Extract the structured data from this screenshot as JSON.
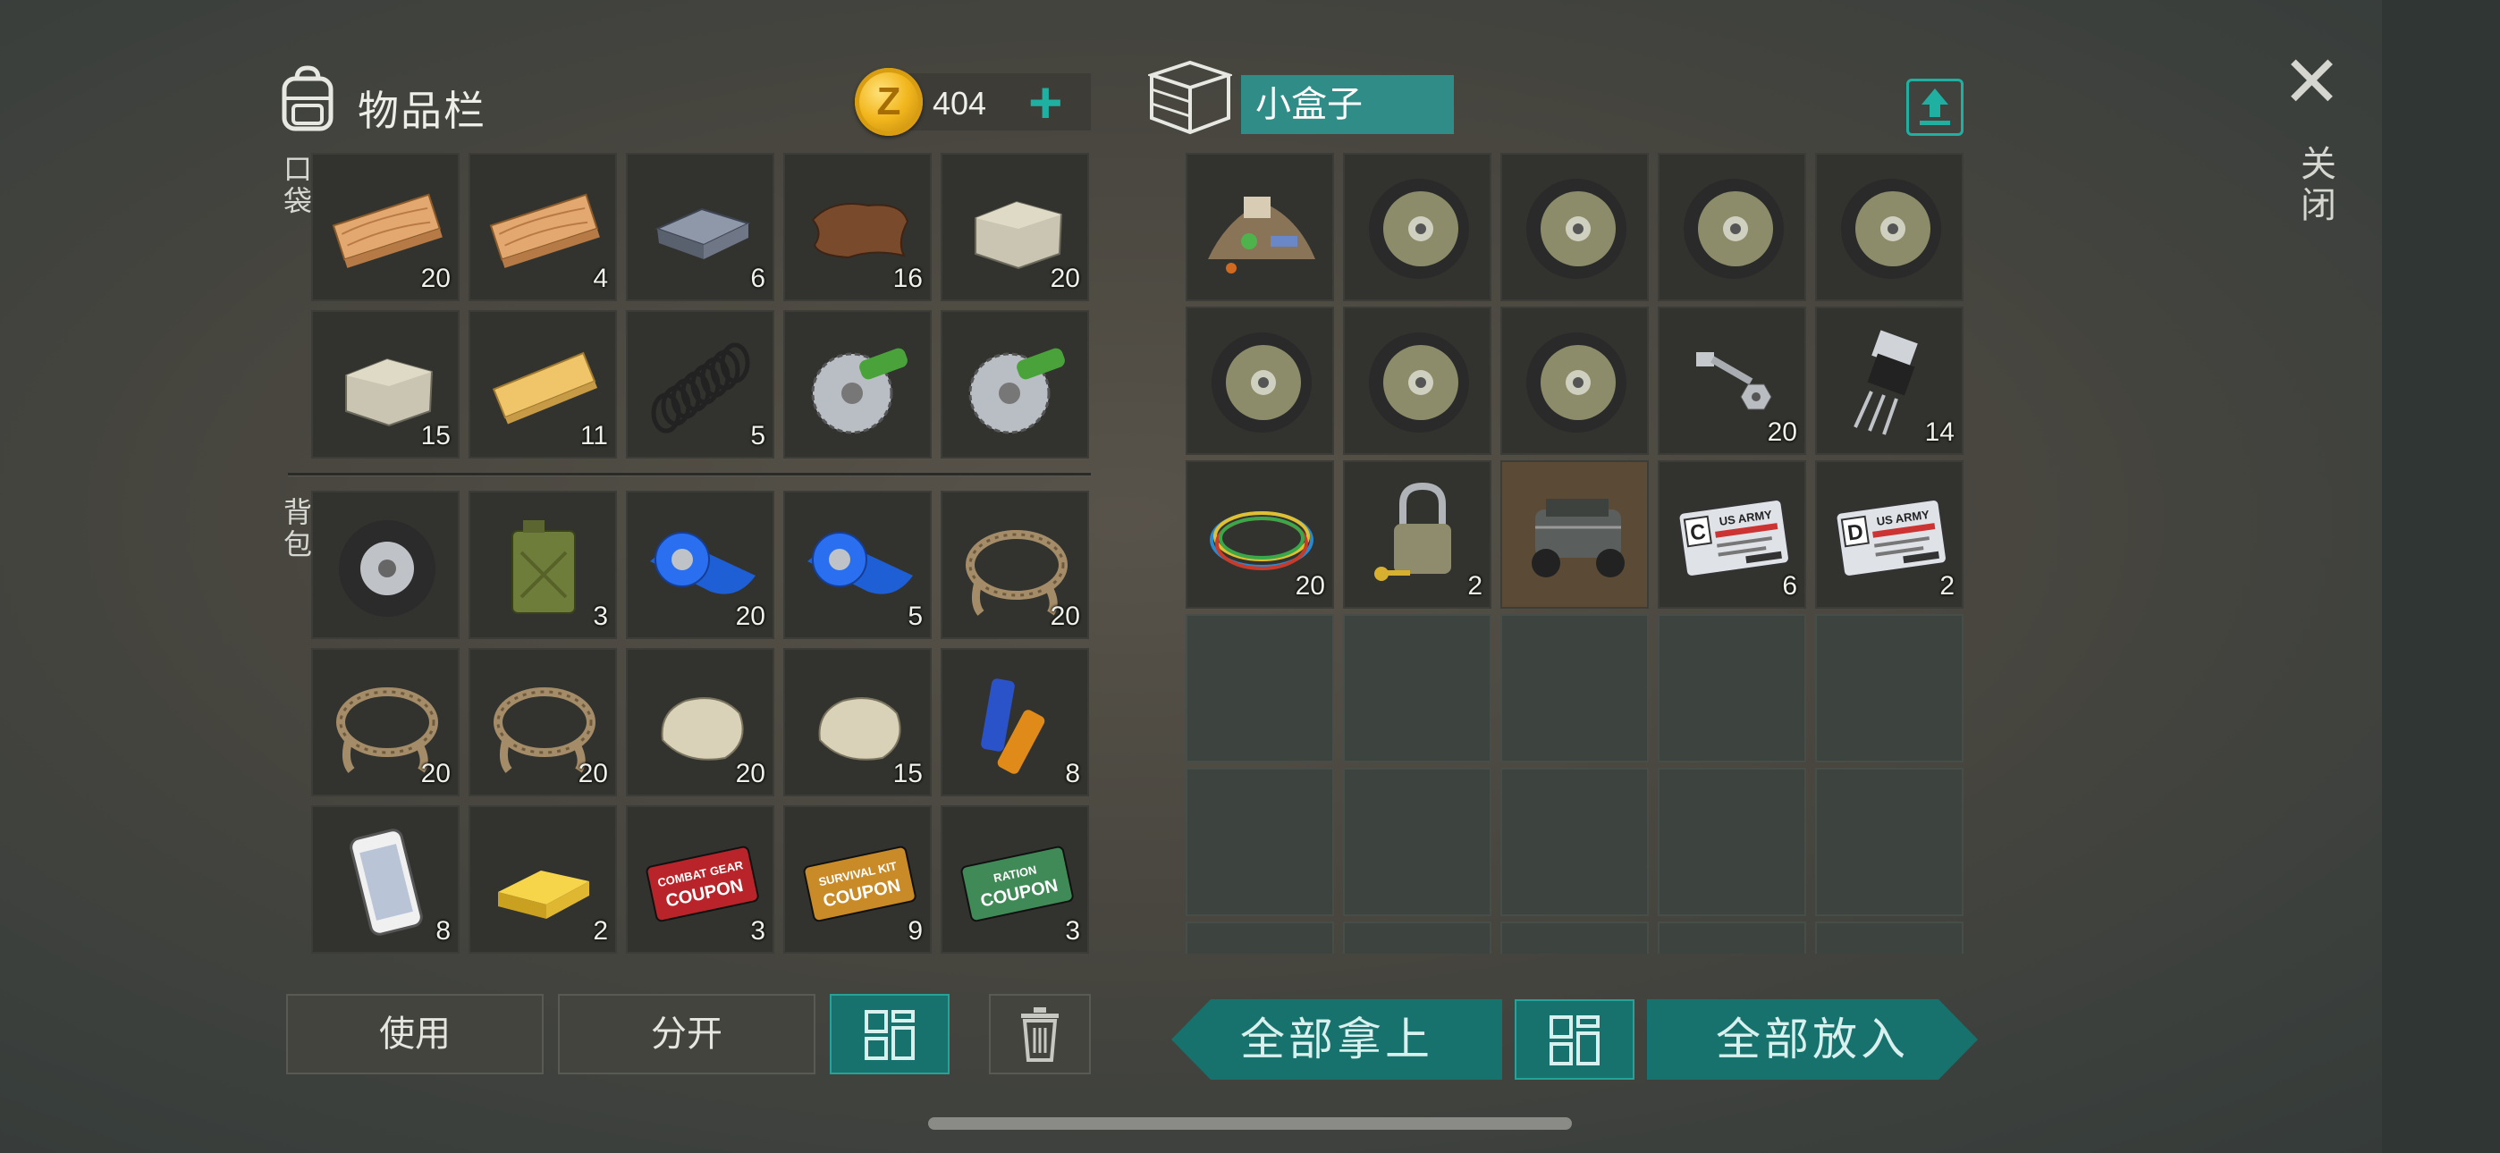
{
  "inventory": {
    "title": "物品栏",
    "gold": "404",
    "coin_letter": "Z",
    "section_pocket": "口袋",
    "section_backpack": "背包",
    "pocket": [
      {
        "item": "plank",
        "qty": "20"
      },
      {
        "item": "plank",
        "qty": "4"
      },
      {
        "item": "iron-ingot",
        "qty": "6"
      },
      {
        "item": "leather",
        "qty": "16"
      },
      {
        "item": "stone-block",
        "qty": "20"
      },
      {
        "item": "stone-block",
        "qty": "15"
      },
      {
        "item": "pine-plank",
        "qty": "11"
      },
      {
        "item": "spring",
        "qty": "5"
      },
      {
        "item": "saw-blade",
        "qty": ""
      },
      {
        "item": "saw-blade",
        "qty": ""
      }
    ],
    "backpack": [
      {
        "item": "tire",
        "qty": ""
      },
      {
        "item": "jerrycan",
        "qty": "3"
      },
      {
        "item": "blue-tape",
        "qty": "20"
      },
      {
        "item": "blue-tape",
        "qty": "5"
      },
      {
        "item": "rope",
        "qty": "20"
      },
      {
        "item": "rope",
        "qty": "20"
      },
      {
        "item": "rope",
        "qty": "20"
      },
      {
        "item": "stone",
        "qty": "20"
      },
      {
        "item": "stone",
        "qty": "15"
      },
      {
        "item": "batteries",
        "qty": "8"
      },
      {
        "item": "smartphone",
        "qty": "8"
      },
      {
        "item": "gold-bar",
        "qty": "2"
      },
      {
        "item": "combat-gear-coupon",
        "qty": "3"
      },
      {
        "item": "survival-kit-coupon",
        "qty": "9"
      },
      {
        "item": "ration-coupon",
        "qty": "3"
      }
    ],
    "coupon_texts": {
      "combat": [
        "COMBAT GEAR",
        "COUPON"
      ],
      "survival": [
        "SURVIVAL KIT",
        "COUPON"
      ],
      "ration": [
        "RATION",
        "COUPON"
      ]
    },
    "buttons": {
      "use": "使用",
      "split": "分开"
    }
  },
  "container": {
    "name": "小盒子",
    "items": [
      {
        "item": "junk-pile",
        "qty": ""
      },
      {
        "item": "wheel",
        "qty": ""
      },
      {
        "item": "wheel",
        "qty": ""
      },
      {
        "item": "wheel",
        "qty": ""
      },
      {
        "item": "wheel",
        "qty": ""
      },
      {
        "item": "wheel",
        "qty": ""
      },
      {
        "item": "wheel",
        "qty": ""
      },
      {
        "item": "wheel",
        "qty": ""
      },
      {
        "item": "bolts",
        "qty": "20"
      },
      {
        "item": "transistor",
        "qty": "14"
      },
      {
        "item": "wires",
        "qty": "20"
      },
      {
        "item": "padlock",
        "qty": "2"
      },
      {
        "item": "atv-blueprint",
        "qty": ""
      },
      {
        "item": "army-card-c",
        "qty": "6"
      },
      {
        "item": "army-card-d",
        "qty": "2"
      }
    ],
    "card_texts": {
      "c_letter": "C",
      "d_letter": "D",
      "card_header": "US ARMY"
    },
    "take_all": "全部拿上",
    "put_all": "全部放入"
  },
  "close_label": "关闭",
  "colors": {
    "accent": "#1fb0a2",
    "accent_dark": "#17716c",
    "box_name_bg": "#2f8c86"
  }
}
